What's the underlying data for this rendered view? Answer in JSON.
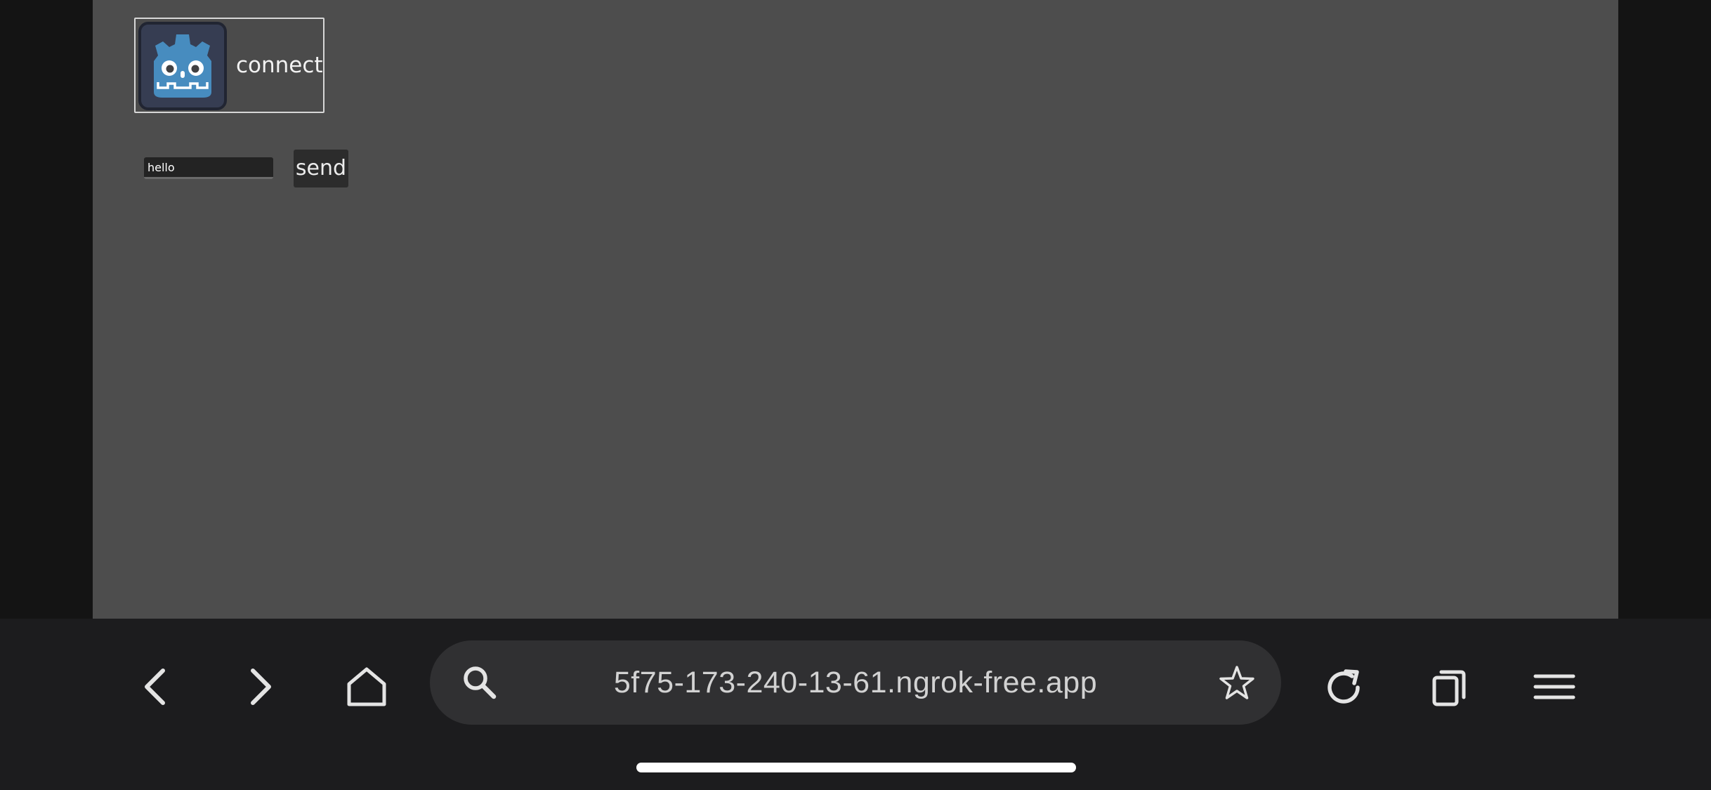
{
  "game": {
    "connect_label": "connect",
    "message_value": "hello",
    "send_label": "send"
  },
  "browser": {
    "url": "5f75-173-240-13-61.ngrok-free.app",
    "buttons": {
      "back": "back-icon",
      "forward": "forward-icon",
      "home": "home-icon",
      "search": "search-icon",
      "bookmark": "star-icon",
      "reload": "reload-icon",
      "tabs": "tabs-icon",
      "menu": "menu-icon"
    }
  },
  "colors": {
    "viewport_bg": "#4d4d4d",
    "toolbar_bg": "#1c1c1e",
    "url_bar_bg": "#303032",
    "godot_blue": "#478cbf",
    "icon_bg": "#363d52"
  }
}
